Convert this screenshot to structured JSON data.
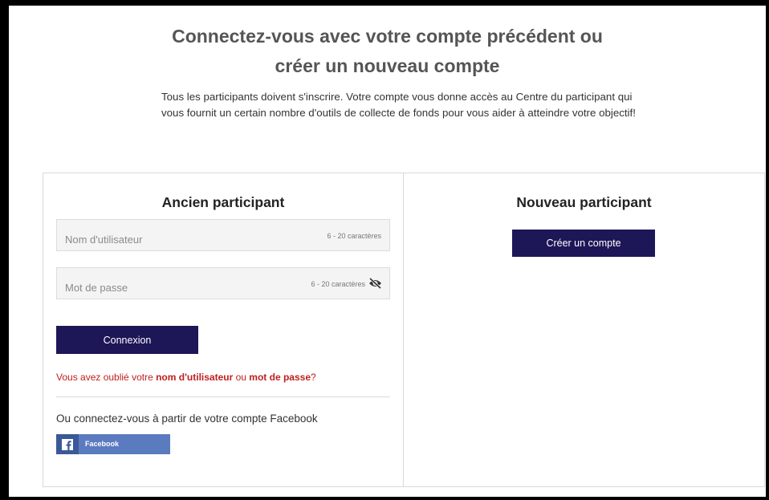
{
  "header": {
    "title_line1": "Connectez-vous avec votre compte précédent ou",
    "title_line2": "créer un nouveau compte",
    "intro": "Tous les participants doivent s'inscrire. Votre compte vous donne accès au Centre du participant qui vous fournit un certain nombre d'outils de collecte de fonds pour vous aider à atteindre votre objectif!"
  },
  "returning": {
    "heading": "Ancien participant",
    "username": {
      "placeholder": "Nom d'utilisateur",
      "value": "",
      "hint": "6 - 20 caractères"
    },
    "password": {
      "placeholder": "Mot de passe",
      "value": "",
      "hint": "6 - 20 caractères",
      "icon": "eye-slash-icon"
    },
    "login_label": "Connexion",
    "forgot": {
      "prefix": "Vous avez oublié votre ",
      "username_link": "nom d'utilisateur",
      "middle": " ou ",
      "password_link": "mot de passe",
      "suffix": "?"
    },
    "facebook": {
      "text": "Ou connectez-vous à partir de votre compte Facebook",
      "button_label": "Facebook",
      "icon": "facebook-icon"
    }
  },
  "new": {
    "heading": "Nouveau participant",
    "create_label": "Créer un compte"
  },
  "colors": {
    "primary": "#1d1757",
    "link_red": "#c0201f",
    "facebook": "#5b7bc0"
  }
}
